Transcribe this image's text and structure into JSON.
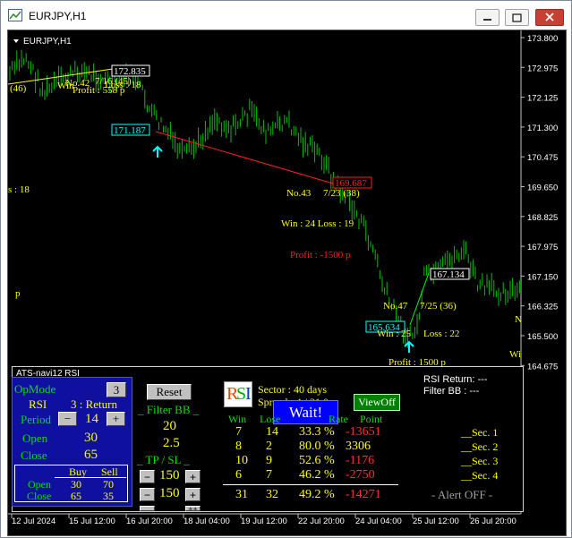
{
  "window": {
    "title": "EURJPY,H1"
  },
  "chart": {
    "symbol_label": "EURJPY,H1",
    "price_ticks": [
      "173.800",
      "172.975",
      "172.125",
      "171.300",
      "170.475",
      "169.650",
      "168.825",
      "167.975",
      "167.150",
      "166.325",
      "165.500",
      "164.675"
    ],
    "time_ticks": [
      "12 Jul 2024",
      "15 Jul 12:00",
      "16 Jul 20:00",
      "18 Jul 04:00",
      "19 Jul 12:00",
      "22 Jul 20:00",
      "24 Jul 04:00",
      "25 Jul 12:00",
      "26 Jul 20:00"
    ],
    "price_boxes": [
      "172.835",
      "171.187",
      "169.687",
      "167.134",
      "165.634"
    ],
    "annotations": {
      "left_46": "(46)",
      "trade42": "No.42",
      "trade42_frac": "7/16 (45)",
      "win_partial": "Win",
      "loss_18_partial": "Loss : 18",
      "profit_558": "Profit : 558 p",
      "s18": "s : 18",
      "p_left": "p",
      "trade43": "No.43",
      "trade43_frac": "7/23 (38)",
      "win24_loss19": "Win : 24   Loss : 19",
      "profit_minus1500": "Profit : -1500 p",
      "trade47": "No.47",
      "trade47_frac": "7/25 (36)",
      "win25": "Win : 25",
      "loss22": "Loss : 22",
      "profit1500": "Profit : 1500 p",
      "n_right": "N",
      "wi_right": "Wi"
    },
    "colors": {
      "up": "#00ff00",
      "down": "#ff0000",
      "text": "#ffff00"
    }
  },
  "panel": {
    "title": "ATS-navi12  RSI",
    "opmode_label": "OpMode",
    "opmode_value": "3",
    "rsi_label": "RSI",
    "rsi_value": "3 : Return",
    "period_label": "Period",
    "period_value": "14",
    "open_label": "Open",
    "open_value": "30",
    "close_label": "Close",
    "close_value": "65",
    "buy_label": "Buy",
    "sell_label": "Sell",
    "open_row_label": "Open",
    "open_buy": "30",
    "open_sell": "70",
    "close_row_label": "Close",
    "close_buy": "65",
    "close_sell": "35",
    "reset_label": "Reset",
    "filterbb_label": "_ Filter BB _",
    "filterbb_v1": "20",
    "filterbb_v2": "2.5",
    "tpsl_label": "_ TP  /  SL _",
    "tp_value": "150",
    "sl_value": "150",
    "minus": "−",
    "plus": "+",
    "plusplus": "++",
    "logo_letters": [
      "R",
      "S",
      "I"
    ],
    "sector_label": "Sector : 40 days",
    "spread_label": "Spread : 4 / 21.0",
    "wait_label": "Wait!",
    "viewoff_label": "ViewOff",
    "stats_headers": [
      "Win",
      "Lose",
      "Rate",
      "Point"
    ],
    "stats_rows": [
      [
        "7",
        "14",
        "33.3 %",
        "-13651"
      ],
      [
        "8",
        "2",
        "80.0 %",
        "3306"
      ],
      [
        "10",
        "9",
        "52.6 %",
        "-1176"
      ],
      [
        "6",
        "7",
        "46.2 %",
        "-2750"
      ]
    ],
    "stats_total": [
      "31",
      "32",
      "49.2 %",
      "-14271"
    ],
    "rsi_return": "RSI Return: ---",
    "filter_bb": "Filter BB  : ---",
    "secs": [
      "__Sec. 1",
      "__Sec. 2",
      "__Sec. 3",
      "__Sec. 4"
    ],
    "alert": "- Alert OFF -"
  }
}
